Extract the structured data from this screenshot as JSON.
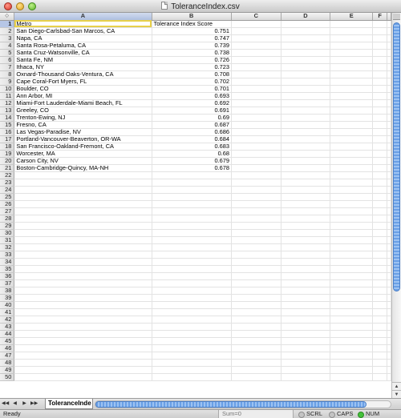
{
  "window": {
    "title": "ToleranceIndex.csv"
  },
  "grid": {
    "corner": "◇",
    "columns": [
      "A",
      "B",
      "C",
      "D",
      "E",
      "F"
    ],
    "selected_column": "A",
    "selected_row": 1,
    "active_cell": "A1",
    "row_count": 50,
    "rows": [
      [
        "Metro",
        "Tolerance Index Score"
      ],
      [
        "San Diego-Carlsbad-San Marcos, CA",
        "0.751"
      ],
      [
        "Napa, CA",
        "0.747"
      ],
      [
        "Santa Rosa-Petaluma, CA",
        "0.739"
      ],
      [
        "Santa Cruz-Watsonville, CA",
        "0.738"
      ],
      [
        "Santa Fe, NM",
        "0.726"
      ],
      [
        "Ithaca, NY",
        "0.723"
      ],
      [
        "Oxnard-Thousand Oaks-Ventura, CA",
        "0.708"
      ],
      [
        "Cape Coral-Fort Myers, FL",
        "0.702"
      ],
      [
        "Boulder, CO",
        "0.701"
      ],
      [
        "Ann Arbor, MI",
        "0.693"
      ],
      [
        "Miami-Fort Lauderdale-Miami Beach, FL",
        "0.692"
      ],
      [
        "Greeley, CO",
        "0.691"
      ],
      [
        "Trenton-Ewing, NJ",
        "0.69"
      ],
      [
        "Fresno, CA",
        "0.687"
      ],
      [
        "Las Vegas-Paradise, NV",
        "0.686"
      ],
      [
        "Portland-Vancouver-Beaverton, OR-WA",
        "0.684"
      ],
      [
        "San Francisco-Oakland-Fremont, CA",
        "0.683"
      ],
      [
        "Worcester, MA",
        "0.68"
      ],
      [
        "Carson City, NV",
        "0.679"
      ],
      [
        "Boston-Cambridge-Quincy, MA-NH",
        "0.678"
      ]
    ]
  },
  "tabs": {
    "sheet_name": "ToleranceInde",
    "nav": [
      "◀◀",
      "◀",
      "▶",
      "▶▶"
    ]
  },
  "status": {
    "ready": "Ready",
    "sum": "Sum=0",
    "indicators": [
      {
        "label": "SCRL",
        "on": false
      },
      {
        "label": "CAPS",
        "on": false
      },
      {
        "label": "NUM",
        "on": true
      }
    ]
  },
  "colors": {
    "selection": "#b6c6e6",
    "active_cell_border": "#e7d04b",
    "scroll_thumb": "#6aa0e6",
    "num_lock": "#44c23a"
  }
}
